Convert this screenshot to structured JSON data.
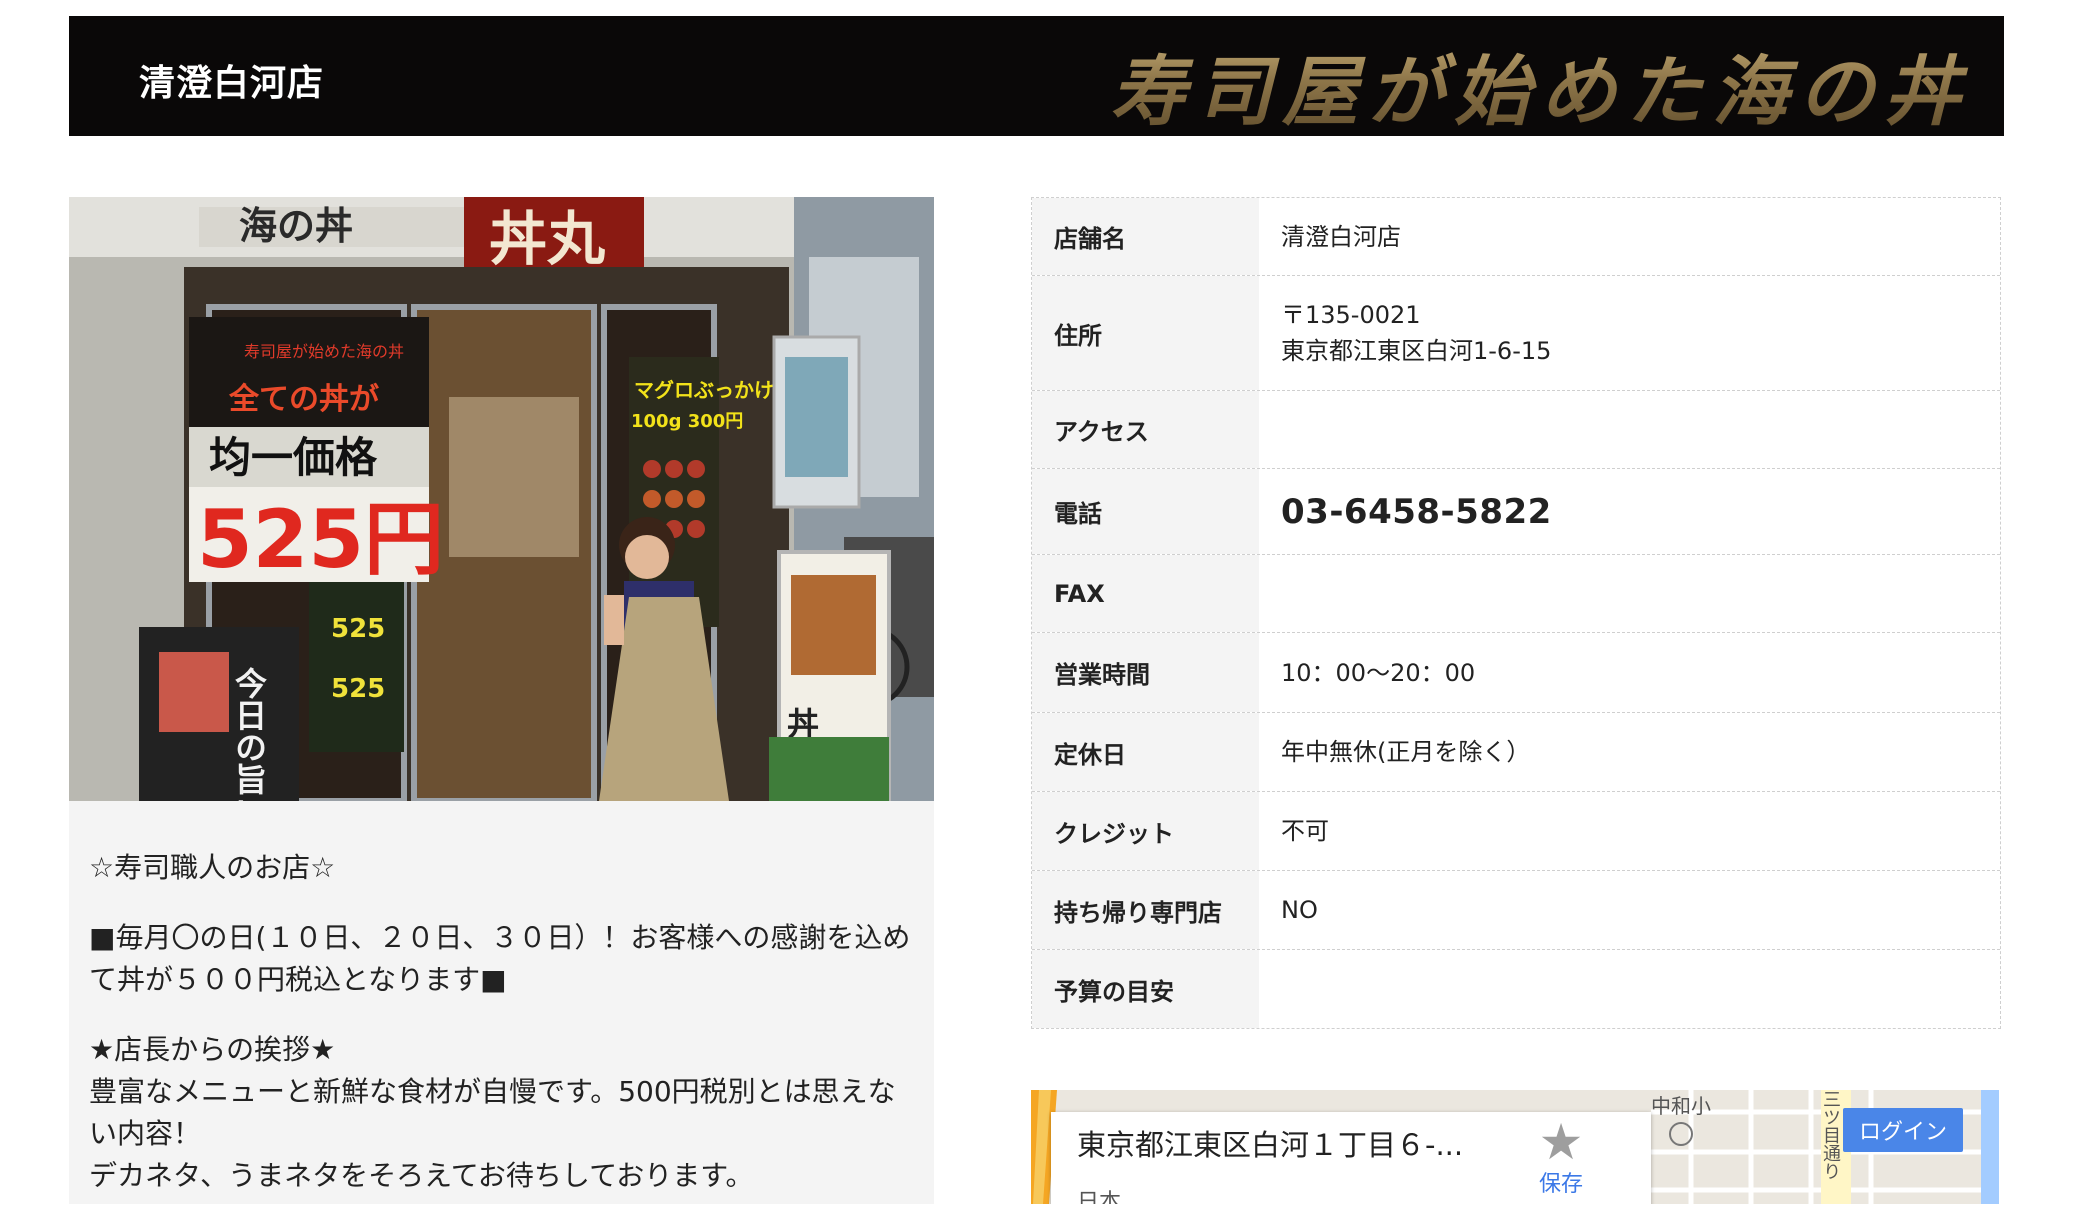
{
  "header": {
    "store_name": "清澄白河店",
    "brand_logo_text": "寿司屋が始めた海の丼"
  },
  "photo": {
    "sign_main": "丼丸",
    "sign_sub": "海の丼",
    "poster_line1": "寿司屋が始めた海の丼",
    "poster_line2": "全ての丼が",
    "poster_line3": "均一価格",
    "poster_price": "525円",
    "poster_tuna": "マグロぶっかけ丼",
    "poster_tuna_price": "100g 300円",
    "board_today": "今日の旨い",
    "stand_sign": "丼丸",
    "menu_price1": "525",
    "menu_price2": "525"
  },
  "description": {
    "p1": "☆寿司職人のお店☆",
    "p2": "■毎月〇の日(１０日、２０日、３０日）！お客様への感謝を込めて丼が５００円税込となります■",
    "p3": "★店長からの挨拶★\n豊富なメニューと新鮮な食材が自慢です。500円税別とは思えない内容！\nデカネタ、うまネタをそろえてお待ちしております。"
  },
  "info": [
    {
      "key": "店舗名",
      "lines": [
        "清澄白河店"
      ]
    },
    {
      "key": "住所",
      "lines": [
        "〒135-0021",
        "東京都江東区白河1-6-15"
      ]
    },
    {
      "key": "アクセス",
      "lines": []
    },
    {
      "key": "電話",
      "lines": [
        "03-6458-5822"
      ]
    },
    {
      "key": "FAX",
      "lines": []
    },
    {
      "key": "営業時間",
      "lines": [
        "10：00〜20：00"
      ]
    },
    {
      "key": "定休日",
      "lines": [
        "年中無休(正月を除く）"
      ]
    },
    {
      "key": "クレジット",
      "lines": [
        "不可"
      ]
    },
    {
      "key": "持ち帰り専門店",
      "lines": [
        "NO"
      ]
    },
    {
      "key": "予算の目安",
      "lines": []
    }
  ],
  "map": {
    "address": "東京都江東区白河１丁目６-...",
    "country": "日本",
    "save_label": "保存",
    "login_label": "ログイン",
    "label_school": "中和小",
    "label_street": "三ツ目通り",
    "star_icon": "star-icon"
  }
}
